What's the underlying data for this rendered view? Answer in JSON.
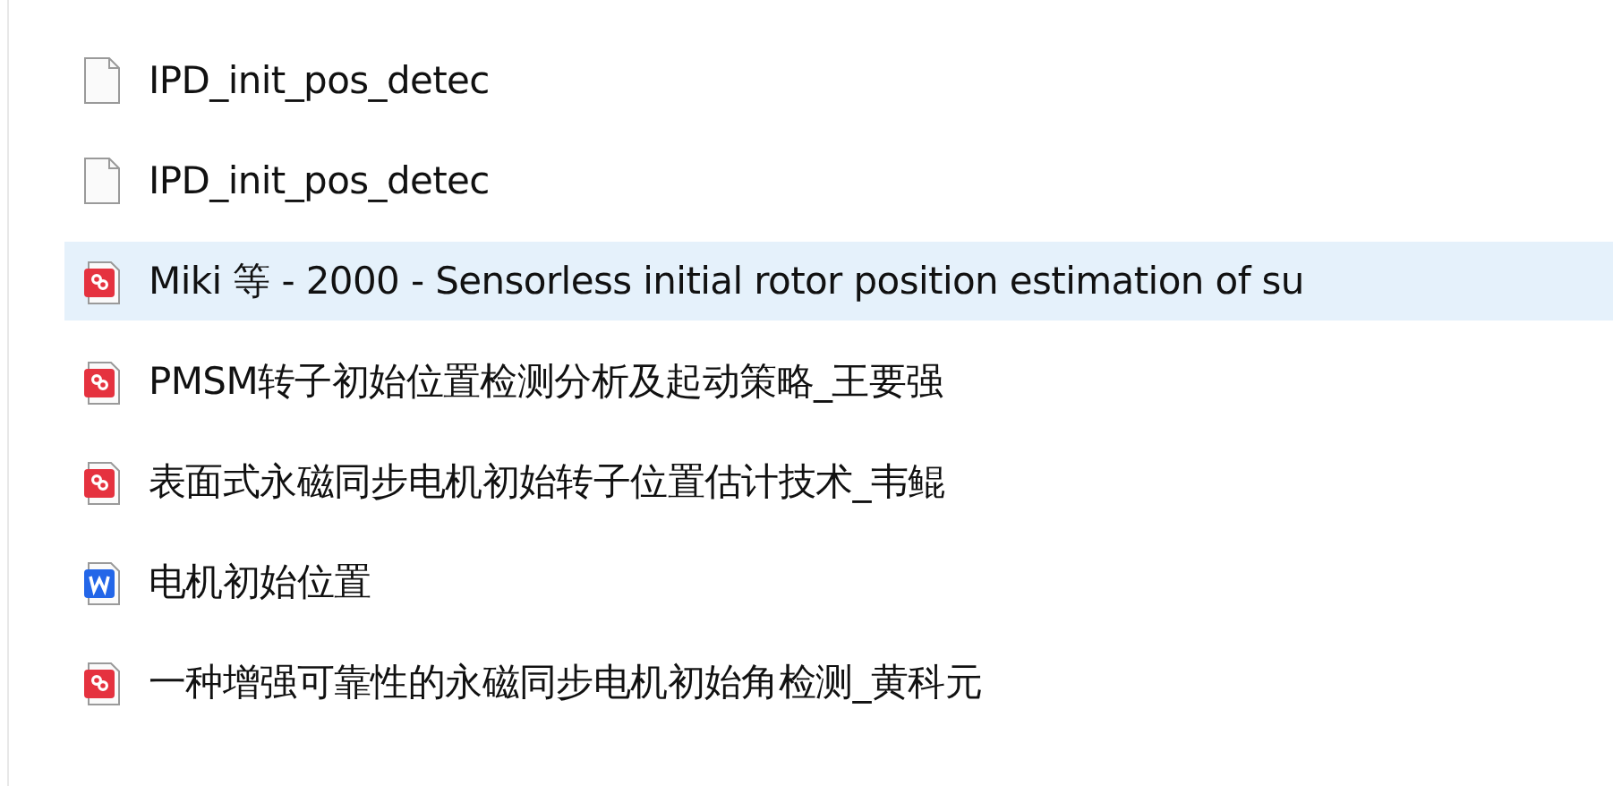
{
  "files": [
    {
      "name": "IPD_init_pos_detec",
      "kind": "file",
      "selected": false
    },
    {
      "name": "IPD_init_pos_detec",
      "kind": "file",
      "selected": false
    },
    {
      "name": "Miki 等 - 2000 - Sensorless initial rotor position estimation of su",
      "kind": "pdf",
      "selected": true
    },
    {
      "name": "PMSM转子初始位置检测分析及起动策略_王要强",
      "kind": "pdf",
      "selected": false
    },
    {
      "name": "表面式永磁同步电机初始转子位置估计技术_韦鲲",
      "kind": "pdf",
      "selected": false
    },
    {
      "name": "电机初始位置",
      "kind": "word",
      "selected": false
    },
    {
      "name": "一种增强可靠性的永磁同步电机初始角检测_黄科元",
      "kind": "pdf",
      "selected": false
    }
  ]
}
